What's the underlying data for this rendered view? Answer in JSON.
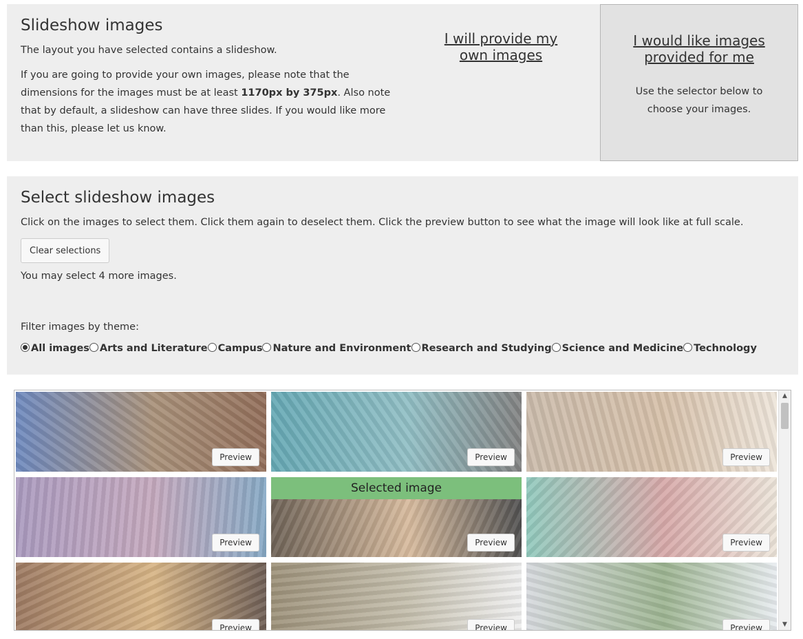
{
  "intro": {
    "title": "Slideshow images",
    "line1": "The layout you have selected contains a slideshow.",
    "para_before": "If you are going to provide your own images, please note that the dimensions for the images must be at least ",
    "para_bold": "1170px by 375px",
    "para_after": ". Also note that by default, a slideshow can have three slides. If you would like more than this, please let us know.",
    "own_images_link": "I will provide my own images",
    "provided_link": "I would like images provided for me",
    "provided_note": "Use the selector below to choose your images."
  },
  "select": {
    "title": "Select slideshow images",
    "instructions": "Click on the images to select them. Click them again to deselect them. Click the preview button to see what the image will look like at full scale.",
    "clear_button": "Clear selections",
    "remaining": "You may select 4 more images.",
    "filter_label": "Filter images by theme:",
    "filters": [
      {
        "label": "All images",
        "checked": true
      },
      {
        "label": "Arts and Literature",
        "checked": false
      },
      {
        "label": "Campus",
        "checked": false
      },
      {
        "label": "Nature and Environment",
        "checked": false
      },
      {
        "label": "Research and Studying",
        "checked": false
      },
      {
        "label": "Science and Medicine",
        "checked": false
      },
      {
        "label": "Technology",
        "checked": false
      }
    ]
  },
  "gallery": {
    "preview_label": "Preview",
    "selected_label": "Selected image",
    "images": [
      {
        "name": "paintbrush-books",
        "selected": false,
        "colors": [
          "#3a5fa8",
          "#8a6a4a",
          "#6b3a1e"
        ]
      },
      {
        "name": "ballet-dancers",
        "selected": false,
        "colors": [
          "#2f8a9a",
          "#6aa8b0",
          "#555555"
        ]
      },
      {
        "name": "statue-quill",
        "selected": false,
        "colors": [
          "#b9a48e",
          "#c7a98a",
          "#e8dccd"
        ]
      },
      {
        "name": "damask-pattern",
        "selected": false,
        "colors": [
          "#8c76a8",
          "#b08aa6",
          "#5a8ab0"
        ]
      },
      {
        "name": "open-book",
        "selected": true,
        "colors": [
          "#3a2a1a",
          "#c9a27a",
          "#111111"
        ]
      },
      {
        "name": "tile-mosaic",
        "selected": false,
        "colors": [
          "#6ab7a6",
          "#c98a8a",
          "#e6dccd"
        ]
      },
      {
        "name": "theatre-interior",
        "selected": false,
        "colors": [
          "#7a4a2a",
          "#c99a5a",
          "#3a2418"
        ]
      },
      {
        "name": "students-laptop",
        "selected": false,
        "colors": [
          "#7a6a4a",
          "#b0a890",
          "#e9e9e9"
        ]
      },
      {
        "name": "campus-buildings",
        "selected": false,
        "colors": [
          "#c8ccd2",
          "#7a9a6a",
          "#dfe5ea"
        ]
      }
    ]
  },
  "scrollbar": {
    "up_icon": "▲",
    "down_icon": "▼"
  }
}
